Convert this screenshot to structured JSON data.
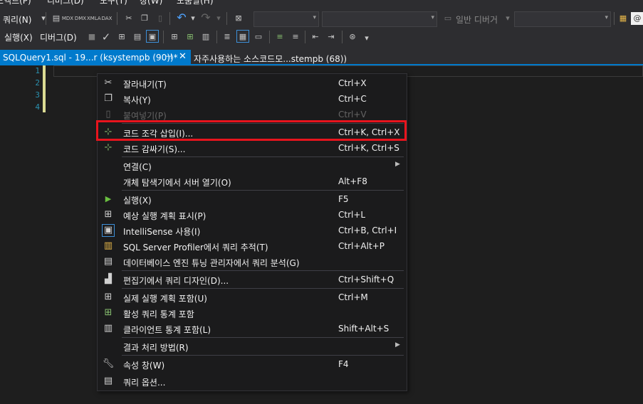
{
  "menubar": {
    "items": [
      "도엑드(P)",
      "디버그(D)",
      "도구(T)",
      "창(W)",
      "도움말(H)"
    ]
  },
  "toolbar1": {
    "query_menu": "쿼리(N)",
    "general_debugger": "일반 디버거",
    "icon_labels": [
      "MDX",
      "DMX",
      "XMLA",
      "DAX"
    ]
  },
  "toolbar2": {
    "execute": "실행(X)",
    "debug": "디버그(D)"
  },
  "tabs": {
    "active_title": "SQLQuery1.sql - 19...r (ksystempb (90))*",
    "pin_icon": "pin-icon",
    "close_icon": "close-icon",
    "inactive_title": "자주사용하는 소스코드모...stempb (68))"
  },
  "editor": {
    "line_numbers": [
      "1",
      "2",
      "3",
      "4"
    ]
  },
  "context_menu": {
    "items": [
      {
        "label": "잘라내기(T)",
        "shortcut": "Ctrl+X",
        "icon": "cut-icon"
      },
      {
        "label": "복사(Y)",
        "shortcut": "Ctrl+C",
        "icon": "copy-icon"
      },
      {
        "label": "붙여넣기(P)",
        "shortcut": "Ctrl+V",
        "icon": "paste-icon",
        "disabled": true
      },
      {
        "label": "코드 조각 삽입(I)...",
        "shortcut": "Ctrl+K, Ctrl+X",
        "icon": "insert-snippet-icon"
      },
      {
        "label": "코드 감싸기(S)...",
        "shortcut": "Ctrl+K, Ctrl+S",
        "icon": "surround-with-icon"
      },
      {
        "label": "연결(C)",
        "shortcut": "",
        "submenu": true
      },
      {
        "label": "개체 탐색기에서 서버 열기(O)",
        "shortcut": "Alt+F8"
      },
      {
        "label": "실행(X)",
        "shortcut": "F5",
        "icon": "execute-icon"
      },
      {
        "label": "예상 실행 계획 표시(P)",
        "shortcut": "Ctrl+L",
        "icon": "estimated-plan-icon"
      },
      {
        "label": "IntelliSense 사용(I)",
        "shortcut": "Ctrl+B, Ctrl+I",
        "icon": "intellisense-icon"
      },
      {
        "label": "SQL Server Profiler에서 쿼리 추적(T)",
        "shortcut": "Ctrl+Alt+P",
        "icon": "profiler-icon"
      },
      {
        "label": "데이터베이스 엔진 튜닝 관리자에서 쿼리 분석(G)",
        "shortcut": "",
        "icon": "tuning-advisor-icon"
      },
      {
        "label": "편집기에서 쿼리 디자인(D)...",
        "shortcut": "Ctrl+Shift+Q",
        "icon": "query-designer-icon"
      },
      {
        "label": "실제 실행 계획 포함(U)",
        "shortcut": "Ctrl+M",
        "icon": "actual-plan-icon"
      },
      {
        "label": "활성 쿼리 통계 포함",
        "shortcut": "",
        "icon": "live-stats-icon"
      },
      {
        "label": "클라이언트 통계 포함(L)",
        "shortcut": "Shift+Alt+S",
        "icon": "client-stats-icon"
      },
      {
        "label": "결과 처리 방법(R)",
        "shortcut": "",
        "submenu": true
      },
      {
        "label": "속성 창(W)",
        "shortcut": "F4",
        "icon": "wrench-icon"
      },
      {
        "label": "쿼리 옵션...",
        "shortcut": "",
        "icon": "query-options-icon"
      }
    ]
  },
  "colors": {
    "accent": "#007acc",
    "highlight": "#e8141d",
    "menu_bg": "#1b1b1c",
    "editor_bg": "#1e1e1e"
  }
}
